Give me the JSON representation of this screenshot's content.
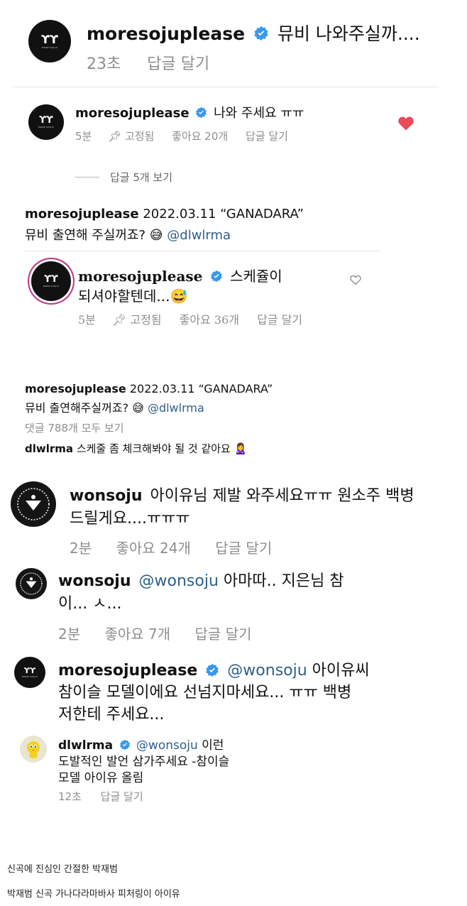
{
  "c1": {
    "username": "moresojuplease",
    "text": "뮤비 나와주실까....",
    "time": "23초",
    "reply": "답글 달기"
  },
  "c2": {
    "username": "moresojuplease",
    "text": "나와 주세요 ㅠㅠ",
    "time": "5분",
    "pinned": "고정됨",
    "likes": "좋아요 20개",
    "reply": "답글 달기",
    "view_replies": "답글 5개 보기"
  },
  "post1": {
    "username": "moresojuplease",
    "date": "2022.03.11 “GANADARA”",
    "text": "뮤비 출연해 주실꺼죠?",
    "emoji": "😅",
    "mention": "@dlwlrma"
  },
  "c3": {
    "username": "moresojuplease",
    "text_line1": "스케쥴이",
    "text_line2": "되셔야할텐데...",
    "emoji": "😅",
    "time": "5분",
    "pinned": "고정됨",
    "likes": "좋아요 36개",
    "reply": "답글 달기"
  },
  "post2": {
    "username": "moresojuplease",
    "date": "2022.03.11 “GANADARA”",
    "text": "뮤비 출연해주실꺼죠?",
    "emoji": "😅",
    "mention": "@dlwlrma",
    "view_all": "댓글 788개 모두 보기",
    "reply_user": "dlwlrma",
    "reply_text": "스케줄 좀 체크해봐야 될 것 같아요",
    "reply_emoji": "🙎‍♀️"
  },
  "c4": {
    "username": "wonsoju",
    "text_line1": "아이유님 제발 와주세요ㅠㅠ 원소주 백병",
    "text_line2": "드릴게요....ㅠㅠㅠ",
    "time": "2분",
    "likes": "좋아요 24개",
    "reply": "답글 달기"
  },
  "c5": {
    "username": "wonsoju",
    "mention": "@wonsoju",
    "text_line1": "아마따.. 지은님 참",
    "text_line2": "이... ㅅ...",
    "time": "2분",
    "likes": "좋아요 7개",
    "reply": "답글 달기"
  },
  "c6": {
    "username": "moresojuplease",
    "mention": "@wonsoju",
    "text_line1": "아이유씨",
    "text_line2": "참이슬 모델이에요 선넘지마세요... ㅠㅠ 백병",
    "text_line3": "저한테 주세요...",
    "avatar_text": "MORE SOJUS"
  },
  "c7": {
    "username": "dlwlrma",
    "mention": "@wonsoju",
    "text_line1": "이런",
    "text_line2": "도발적인 발언 삼가주세요 -참이슬",
    "text_line3": "모델 아이유 올림",
    "time": "12초",
    "reply": "답글 달기"
  },
  "captions": {
    "line1": "신곡에 진심인 간절한 박재범",
    "line2": "박재범 신곡 가나다라마바사 피처링이 아이유"
  },
  "colors": {
    "verified": "#3897f0",
    "heart_red": "#ed4956",
    "meta_gray": "#8e8e8e",
    "mention_blue": "#2f5f8a"
  }
}
